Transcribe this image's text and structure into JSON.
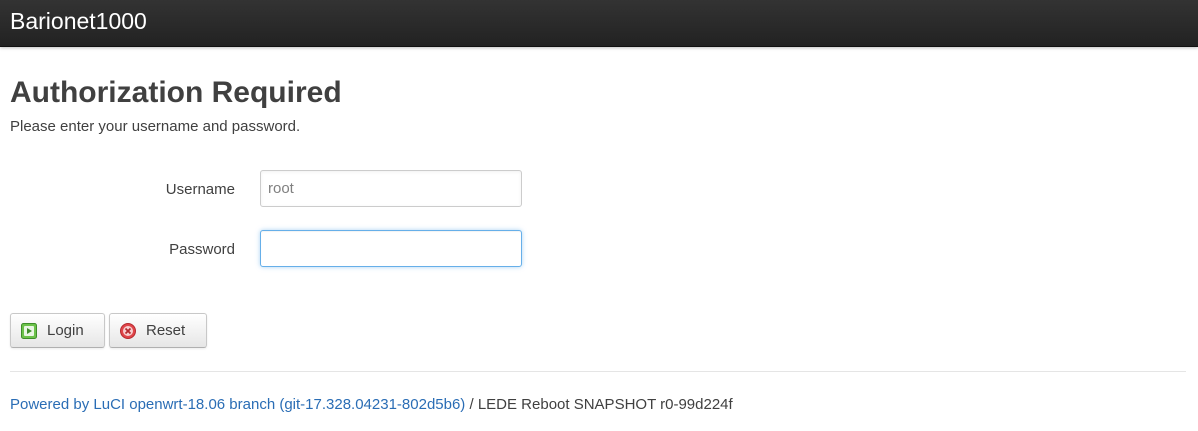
{
  "header": {
    "brand": "Barionet1000"
  },
  "main": {
    "title": "Authorization Required",
    "description": "Please enter your username and password."
  },
  "form": {
    "username_label": "Username",
    "username_value": "root",
    "password_label": "Password",
    "password_value": ""
  },
  "actions": {
    "login_label": "Login",
    "login_icon": "apply-icon",
    "reset_label": "Reset",
    "reset_icon": "reset-icon"
  },
  "footer": {
    "link_text": "Powered by LuCI openwrt-18.06 branch (git-17.328.04231-802d5b6)",
    "separator": " / ",
    "version_text": "LEDE Reboot SNAPSHOT r0-99d224f"
  },
  "colors": {
    "topbar": "#222222",
    "link": "#2a6db5",
    "focus_border": "#66afe9",
    "login_icon_green": "#4caf50",
    "reset_icon_red": "#e0454a"
  }
}
